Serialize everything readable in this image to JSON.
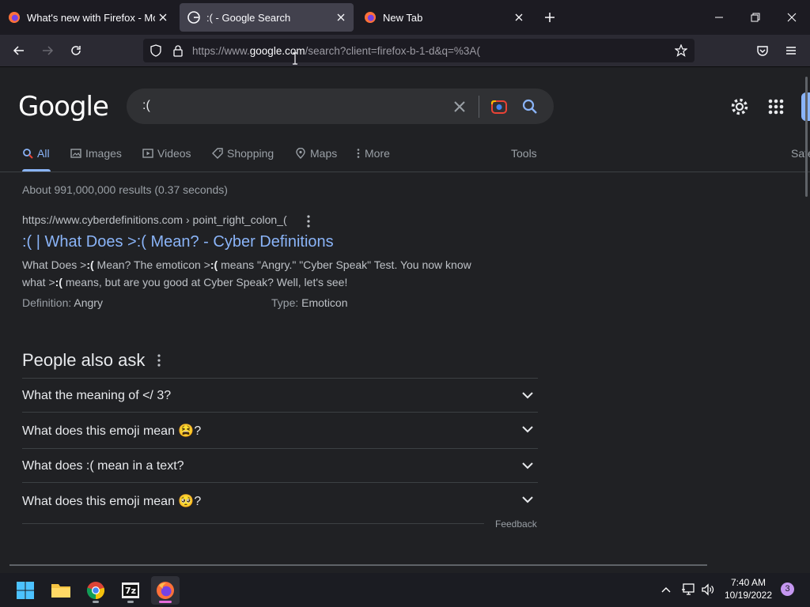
{
  "browser": {
    "tabs": [
      {
        "title": "What's new with Firefox - More"
      },
      {
        "title": ":( - Google Search"
      },
      {
        "title": "New Tab"
      }
    ],
    "url": {
      "prefix": "https://www.",
      "host": "google.com",
      "rest": "/search?client=firefox-b-1-d&q=%3A("
    }
  },
  "google": {
    "logo": "Google",
    "query": ":(",
    "tabs": [
      {
        "label": "All"
      },
      {
        "label": "Images"
      },
      {
        "label": "Videos"
      },
      {
        "label": "Shopping"
      },
      {
        "label": "Maps"
      },
      {
        "label": "More"
      }
    ],
    "tools": "Tools",
    "safe": "Safe",
    "stats": "About 991,000,000 results (0.37 seconds)",
    "result": {
      "cite_host": "https://www.cyberdefinitions.com",
      "cite_path": " › point_right_colon_(",
      "title": ":( | What Does >:( Mean? - Cyber Definitions",
      "snippet": {
        "p1": "What Does >",
        "b1": ":(",
        "p2": " Mean? The emoticon >",
        "b2": ":(",
        "p3": " means \"Angry.\" \"Cyber Speak\" Test. You now know what >",
        "b3": ":(",
        "p4": " means, but are you good at Cyber Speak? Well, let's see!"
      },
      "facts": [
        {
          "label": "Definition: ",
          "value": "Angry"
        },
        {
          "label": "Type: ",
          "value": "Emoticon"
        }
      ]
    },
    "paa": {
      "title": "People also ask",
      "questions": [
        {
          "text": "What the meaning of </ 3?"
        },
        {
          "text": "What does this emoji mean 😫?"
        },
        {
          "text": "What does :( mean in a text?"
        },
        {
          "text": "What does this emoji mean 🥺?"
        }
      ]
    },
    "feedback": "Feedback"
  },
  "taskbar": {
    "time": "7:40 AM",
    "date": "10/19/2022",
    "notifications": "3"
  },
  "colors": {
    "accent": "#8ab4f8",
    "page_bg": "#202124",
    "firefox_active": "#e76cdb"
  }
}
